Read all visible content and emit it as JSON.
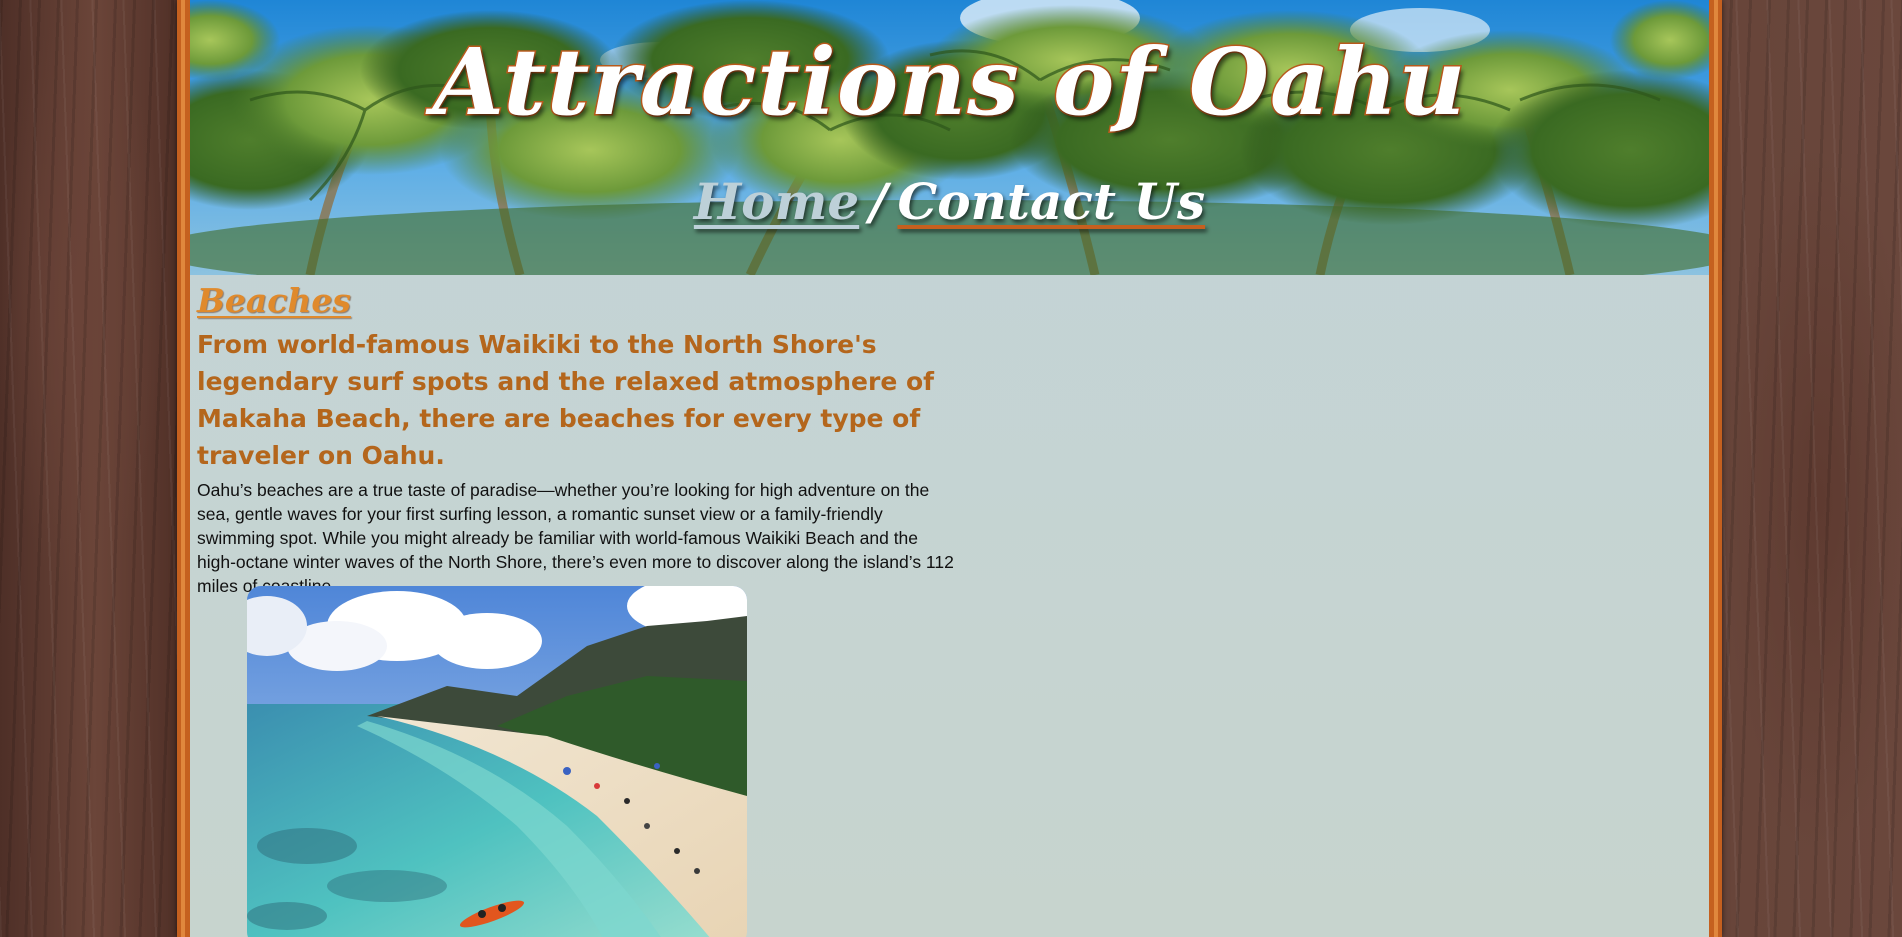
{
  "site": {
    "title": "Attractions of Oahu"
  },
  "nav": {
    "items": [
      {
        "label": "Home"
      },
      {
        "label": "Contact Us"
      }
    ],
    "separator": "/"
  },
  "section": {
    "title": "Beaches",
    "lead": "From world-famous Waikiki to the North Shore's legendary surf spots and the relaxed atmosphere of Makaha Beach, there are beaches for every type of traveler on Oahu.",
    "body": "Oahu’s beaches are a true taste of paradise—whether you’re looking for high adventure on the sea, gentle waves for your first surfing lesson, a romantic sunset view or a family-friendly swimming spot. While you might already be familiar with world-famous Waikiki Beach and the high-octane winter waves of the North Shore, there’s even more to discover along the island’s 112 miles of coastline."
  },
  "colors": {
    "frame": "#c5601f",
    "accent": "#e08a2c",
    "lead_text": "#b4661c",
    "page_bg": "#c5d4d4"
  },
  "images": {
    "header": "palm-trees-banner",
    "photo": "beach-aerial-photo"
  }
}
